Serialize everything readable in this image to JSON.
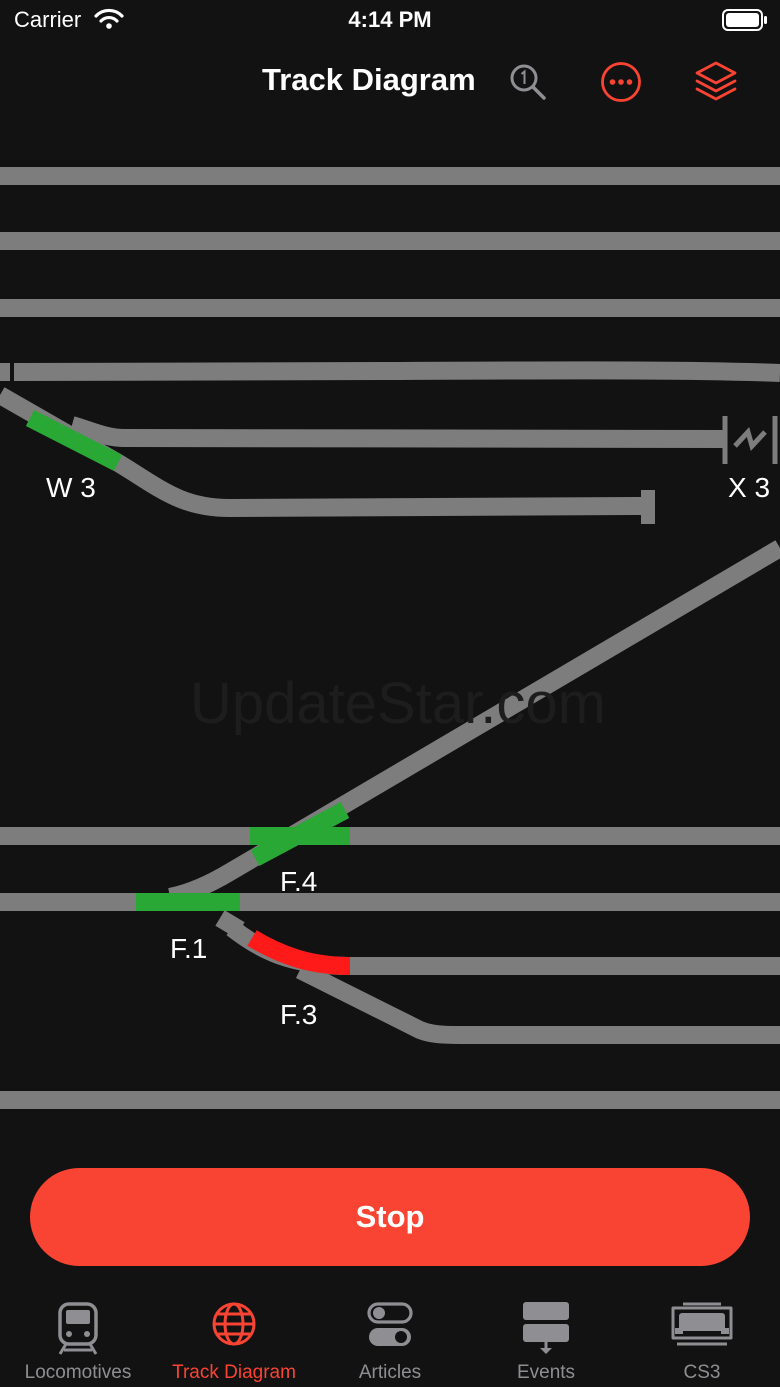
{
  "status_bar": {
    "carrier": "Carrier",
    "time": "4:14 PM"
  },
  "nav": {
    "title": "Track Diagram",
    "icons": [
      "search-icon",
      "more-icon",
      "layers-icon"
    ],
    "accent": "#fa4433"
  },
  "diagram": {
    "labels": {
      "w3": "W 3",
      "x3": "X 3",
      "f4": "F.4",
      "f1": "F.1",
      "f3": "F.3"
    },
    "colors": {
      "track": "#7d7d7d",
      "active": "#2aa835",
      "alert": "#ff1a1a"
    }
  },
  "watermark": "UpdateStar.com",
  "stop_button": {
    "label": "Stop"
  },
  "tabs": [
    {
      "label": "Locomotives",
      "icon": "train-icon",
      "active": false
    },
    {
      "label": "Track Diagram",
      "icon": "globe-icon",
      "active": true
    },
    {
      "label": "Articles",
      "icon": "toggle-icon",
      "active": false
    },
    {
      "label": "Events",
      "icon": "events-icon",
      "active": false
    },
    {
      "label": "CS3",
      "icon": "cs3-icon",
      "active": false
    }
  ]
}
